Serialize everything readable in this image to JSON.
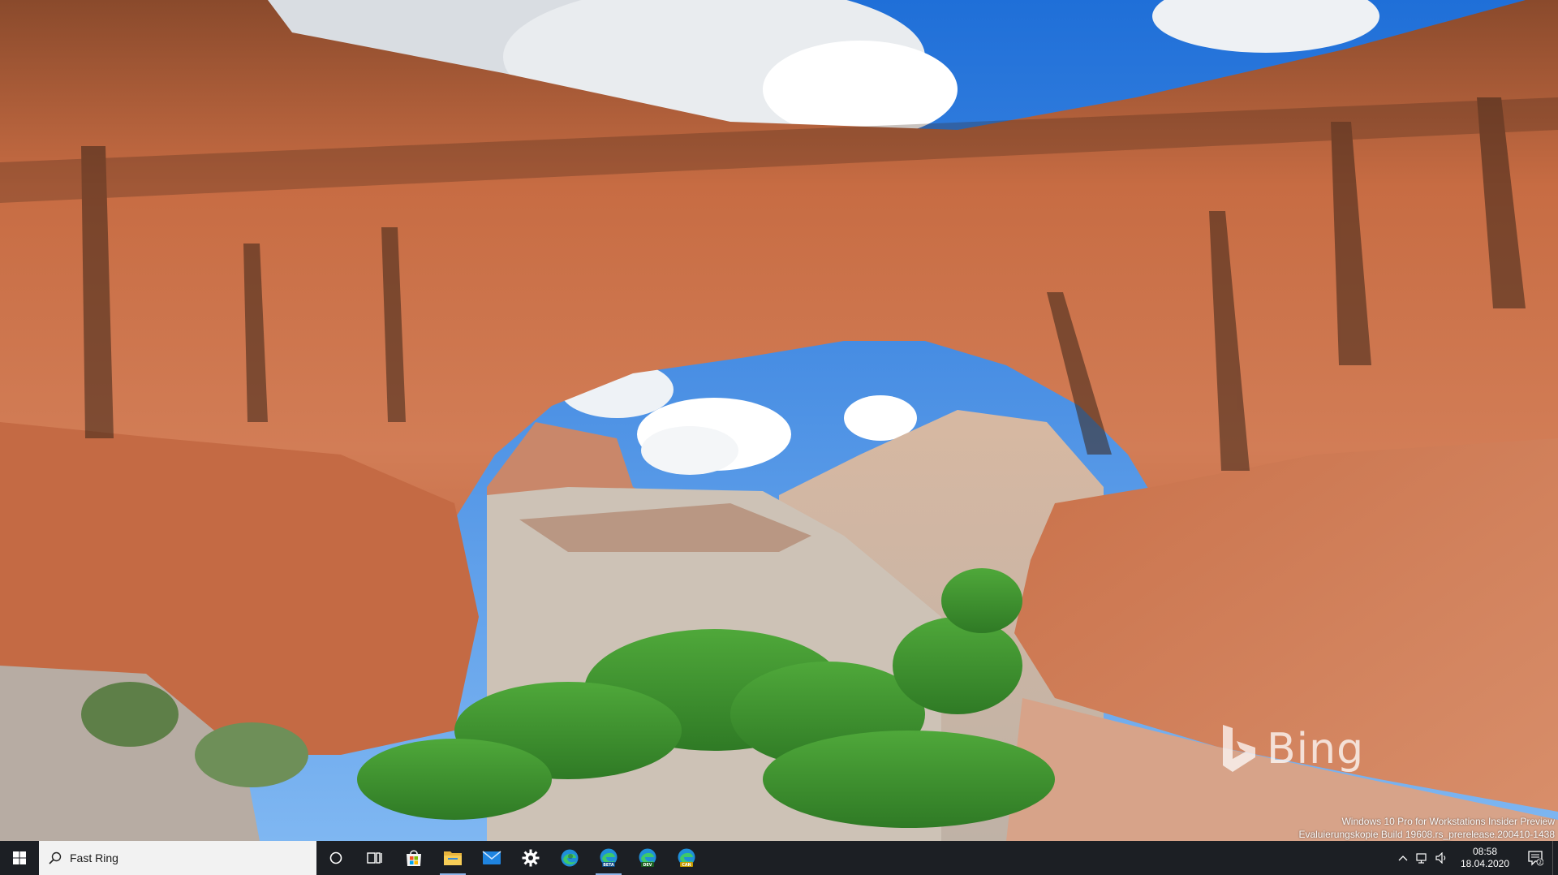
{
  "wallpaper": {
    "brand": "Bing",
    "watermark_line1": "Windows 10 Pro for Workstations Insider Preview",
    "watermark_line2": "Evaluierungskopie Build 19608.rs_prerelease.200410-1438"
  },
  "taskbar": {
    "search_text": "Fast Ring",
    "apps": [
      {
        "name": "Cortana",
        "icon": "cortana-circle-icon"
      },
      {
        "name": "Task View",
        "icon": "task-view-icon"
      },
      {
        "name": "Microsoft Store",
        "icon": "store-icon"
      },
      {
        "name": "File Explorer",
        "icon": "folder-icon"
      },
      {
        "name": "Mail",
        "icon": "mail-icon"
      },
      {
        "name": "Settings",
        "icon": "gear-icon"
      },
      {
        "name": "Microsoft Edge",
        "icon": "edge-icon",
        "badge": ""
      },
      {
        "name": "Microsoft Edge Beta",
        "icon": "edge-beta-icon",
        "badge": "BETA"
      },
      {
        "name": "Microsoft Edge Dev",
        "icon": "edge-dev-icon",
        "badge": "DEV"
      },
      {
        "name": "Microsoft Edge Canary",
        "icon": "edge-canary-icon",
        "badge": "CAN"
      }
    ],
    "clock": {
      "time": "08:58",
      "date": "18.04.2020"
    },
    "notification_count": "2"
  },
  "colors": {
    "taskbar": "#1c1f24",
    "accent": "#0078d7",
    "sky": "#2b7ce0",
    "rock": "#c8673f"
  }
}
